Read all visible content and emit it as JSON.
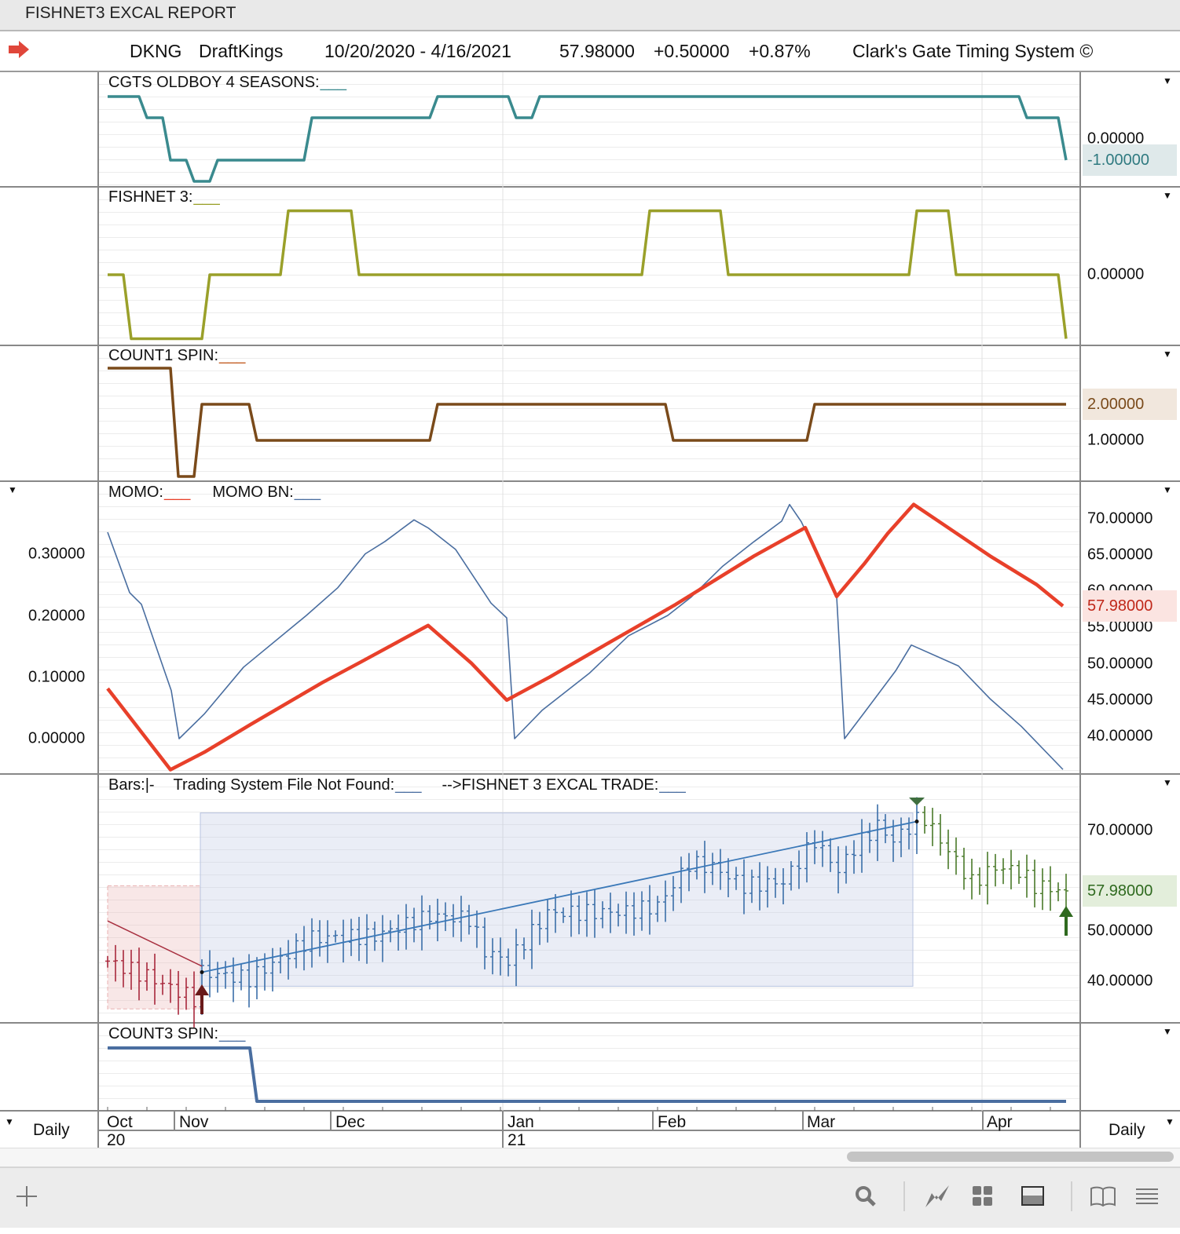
{
  "window_title": "FISHNET3 EXCAL REPORT",
  "info": {
    "symbol": "DKNG",
    "name": "DraftKings",
    "date_range": "10/20/2020 - 4/16/2021",
    "last": "57.98000",
    "change": "+0.50000",
    "change_pct": "+0.87%",
    "system": "Clark's Gate Timing System ©"
  },
  "panels": {
    "oldboy": {
      "title": "CGTS OLDBOY 4 SEASONS:",
      "legend": "___",
      "axis": [
        "0.00000"
      ],
      "current": "-1.00000",
      "color": "#3a8a8e"
    },
    "fishnet": {
      "title": "FISHNET 3:",
      "legend": "___",
      "axis": [
        "0.00000"
      ],
      "color": "#9aa02a"
    },
    "count1": {
      "title": "COUNT1 SPIN:",
      "legend": "___",
      "axis": [
        "1.00000"
      ],
      "current": "2.00000",
      "color": "#7a4a1a"
    },
    "momo": {
      "title": "MOMO:",
      "legend": "___",
      "title2": "MOMO BN:",
      "legend2": "___",
      "left_axis": [
        "0.30000",
        "0.20000",
        "0.10000",
        "0.00000"
      ],
      "right_axis": [
        "70.00000",
        "65.00000",
        "60.00000",
        "55.00000",
        "50.00000",
        "45.00000",
        "40.00000"
      ],
      "current": "57.98000",
      "color": "#e8402a",
      "color2": "#4a6ea0"
    },
    "bars": {
      "title": "Bars:",
      "bar_style": "|-",
      "title2": "Trading System File Not Found:",
      "legend2": "___",
      "title3": "-->FISHNET 3 EXCAL TRADE:",
      "legend3": "___",
      "right_axis": [
        "70.00000",
        "50.00000",
        "40.00000"
      ],
      "current": "57.98000"
    },
    "count3": {
      "title": "COUNT3 SPIN:",
      "legend": "___",
      "color": "#4a6ea0"
    }
  },
  "date_axis": {
    "months": [
      "Oct",
      "Nov",
      "Dec",
      "Jan",
      "Feb",
      "Mar",
      "Apr"
    ],
    "years": [
      "20",
      "21"
    ],
    "period_left": "Daily",
    "period_right": "Daily"
  },
  "toolbar": [
    "add-icon",
    "search-icon",
    "line-chart-icon",
    "grid-icon",
    "panel-icon",
    "book-icon",
    "menu-icon"
  ],
  "chart_data": [
    {
      "type": "line",
      "title": "CGTS OLDBOY 4 SEASONS",
      "x_unit": "trading day from 10/20/2020",
      "ylim": [
        -2,
        2
      ],
      "points": [
        [
          0,
          2
        ],
        [
          4,
          2
        ],
        [
          5,
          1
        ],
        [
          7,
          1
        ],
        [
          8,
          -1
        ],
        [
          10,
          -1
        ],
        [
          11,
          -2
        ],
        [
          13,
          -2
        ],
        [
          14,
          -1
        ],
        [
          25,
          -1
        ],
        [
          26,
          1
        ],
        [
          41,
          1
        ],
        [
          42,
          2
        ],
        [
          51,
          2
        ],
        [
          52,
          1
        ],
        [
          54,
          1
        ],
        [
          55,
          2
        ],
        [
          116,
          2
        ],
        [
          117,
          1
        ],
        [
          121,
          1
        ],
        [
          122,
          -1
        ]
      ]
    },
    {
      "type": "line",
      "title": "FISHNET 3",
      "ylim": [
        -1,
        1
      ],
      "points": [
        [
          0,
          0
        ],
        [
          2,
          0
        ],
        [
          3,
          -1
        ],
        [
          12,
          -1
        ],
        [
          13,
          0
        ],
        [
          22,
          0
        ],
        [
          23,
          1
        ],
        [
          31,
          1
        ],
        [
          32,
          0
        ],
        [
          68,
          0
        ],
        [
          69,
          1
        ],
        [
          78,
          1
        ],
        [
          79,
          0
        ],
        [
          102,
          0
        ],
        [
          103,
          1
        ],
        [
          107,
          1
        ],
        [
          108,
          0
        ],
        [
          121,
          0
        ],
        [
          122,
          -1
        ]
      ]
    },
    {
      "type": "line",
      "title": "COUNT1 SPIN",
      "ylim": [
        0,
        3
      ],
      "points": [
        [
          0,
          3
        ],
        [
          8,
          3
        ],
        [
          9,
          0
        ],
        [
          11,
          0
        ],
        [
          12,
          2
        ],
        [
          18,
          2
        ],
        [
          19,
          1
        ],
        [
          41,
          1
        ],
        [
          42,
          2
        ],
        [
          71,
          2
        ],
        [
          72,
          1
        ],
        [
          89,
          1
        ],
        [
          90,
          2
        ],
        [
          122,
          2
        ]
      ]
    },
    {
      "type": "line",
      "title": "MOMO",
      "axis": "right",
      "points": [
        [
          0,
          46.6
        ],
        [
          8,
          35.4
        ],
        [
          12.3,
          37.8
        ],
        [
          18.3,
          41.7
        ],
        [
          27.3,
          47.4
        ],
        [
          32.3,
          50.3
        ],
        [
          40.8,
          55.3
        ],
        [
          46.3,
          50.1
        ],
        [
          50.8,
          45
        ],
        [
          56.3,
          48.2
        ],
        [
          63.3,
          52.6
        ],
        [
          72.3,
          58.2
        ],
        [
          82.3,
          64.9
        ],
        [
          88.8,
          68.8
        ],
        [
          92.8,
          59.3
        ],
        [
          96.3,
          63.8
        ],
        [
          99.3,
          68
        ],
        [
          102.6,
          72
        ],
        [
          106.3,
          69.3
        ],
        [
          112.3,
          64.9
        ],
        [
          118.3,
          60.9
        ],
        [
          121.6,
          57.98
        ]
      ]
    },
    {
      "type": "line",
      "title": "MOMO BN",
      "axis": "left",
      "points": [
        [
          0,
          0.335
        ],
        [
          2.8,
          0.237
        ],
        [
          4.3,
          0.218
        ],
        [
          8.1,
          0.078
        ],
        [
          9.1,
          0
        ],
        [
          12.3,
          0.04
        ],
        [
          17.3,
          0.116
        ],
        [
          25.3,
          0.2
        ],
        [
          29.3,
          0.245
        ],
        [
          32.8,
          0.3
        ],
        [
          35.3,
          0.32
        ],
        [
          39,
          0.355
        ],
        [
          40.8,
          0.342
        ],
        [
          44.3,
          0.307
        ],
        [
          48.8,
          0.22
        ],
        [
          50.8,
          0.196
        ],
        [
          51.8,
          0
        ],
        [
          55.3,
          0.046
        ],
        [
          61.3,
          0.106
        ],
        [
          66.3,
          0.167
        ],
        [
          71.3,
          0.2
        ],
        [
          74.3,
          0.23
        ],
        [
          78.3,
          0.28
        ],
        [
          82.3,
          0.32
        ],
        [
          85.8,
          0.353
        ],
        [
          86.8,
          0.38
        ],
        [
          88.3,
          0.352
        ],
        [
          92.8,
          0.23
        ],
        [
          93.8,
          0
        ],
        [
          96.3,
          0.042
        ],
        [
          100.3,
          0.11
        ],
        [
          102.3,
          0.152
        ],
        [
          108.3,
          0.118
        ],
        [
          112.3,
          0.065
        ],
        [
          116.3,
          0.02
        ],
        [
          121.6,
          -0.05
        ]
      ]
    },
    {
      "type": "ohlc",
      "title": "Bars",
      "axis": "right",
      "close_keypoints": [
        [
          0,
          44
        ],
        [
          5,
          41
        ],
        [
          11,
          36.5
        ],
        [
          12,
          41.8
        ],
        [
          18,
          40.5
        ],
        [
          26,
          48.6
        ],
        [
          34,
          49
        ],
        [
          41,
          53
        ],
        [
          46,
          52.5
        ],
        [
          48,
          46
        ],
        [
          51,
          44
        ],
        [
          56,
          53.6
        ],
        [
          66,
          53.8
        ],
        [
          70,
          55
        ],
        [
          74,
          63.4
        ],
        [
          77,
          62.8
        ],
        [
          81,
          59
        ],
        [
          86,
          59.8
        ],
        [
          90,
          68
        ],
        [
          93,
          62
        ],
        [
          95,
          66.5
        ],
        [
          98,
          71
        ],
        [
          100,
          68
        ],
        [
          103,
          72
        ],
        [
          104,
          72.5
        ],
        [
          106,
          68
        ],
        [
          108,
          64
        ],
        [
          110,
          59.6
        ],
        [
          113,
          62.7
        ],
        [
          116,
          62
        ],
        [
          118,
          59
        ],
        [
          122,
          57.98
        ]
      ],
      "trend_line": [
        [
          12,
          41.8
        ],
        [
          103,
          71.8
        ]
      ],
      "moving_average": [
        [
          0,
          52
        ],
        [
          12,
          43
        ]
      ],
      "zones": [
        {
          "from_day": 0,
          "to_day": 11.8,
          "low": 34.5,
          "high": 59,
          "color": "#e8b0b0"
        },
        {
          "from_day": 11.8,
          "to_day": 102.5,
          "low": 39,
          "high": 73.5,
          "color": "#b8c4e0"
        }
      ],
      "signals": [
        {
          "day": 12,
          "type": "buy"
        },
        {
          "day": 103,
          "type": "sell"
        },
        {
          "day": 122,
          "type": "buy"
        }
      ]
    },
    {
      "type": "line",
      "title": "COUNT3 SPIN",
      "ylim": [
        0,
        1
      ],
      "points": [
        [
          0,
          1
        ],
        [
          18.1,
          1
        ],
        [
          19,
          0
        ],
        [
          122,
          0
        ]
      ]
    }
  ]
}
